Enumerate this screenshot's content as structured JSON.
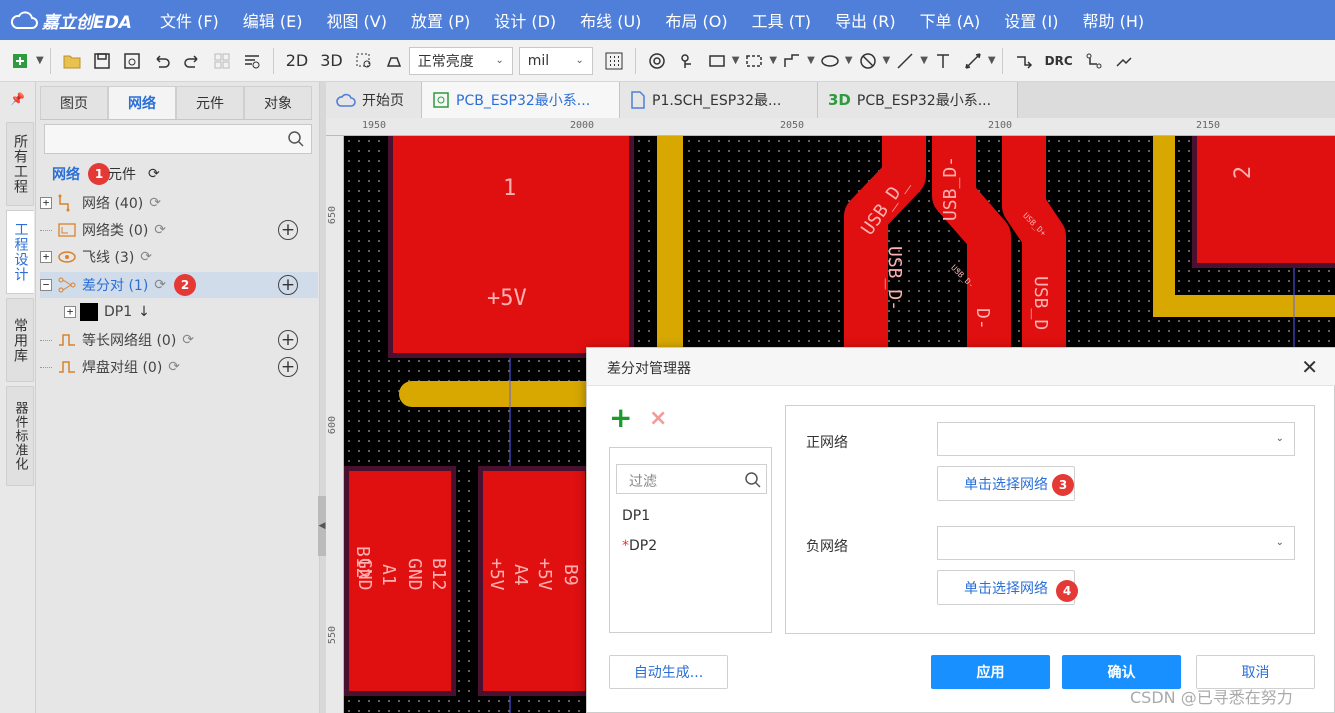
{
  "app": {
    "logo_text": "嘉立创EDA"
  },
  "menu": [
    "文件 (F)",
    "编辑 (E)",
    "视图 (V)",
    "放置 (P)",
    "设计 (D)",
    "布线 (U)",
    "布局 (O)",
    "工具 (T)",
    "导出 (R)",
    "下单 (A)",
    "设置 (I)",
    "帮助 (H)"
  ],
  "toolbar": {
    "view_2d": "2D",
    "view_3d": "3D",
    "brightness": "正常亮度",
    "unit": "mil",
    "drc": "DRC"
  },
  "vtabs": {
    "pin": "⬆",
    "all_projects": "所有工程",
    "project_design": "工程设计",
    "common_lib": "常用库",
    "standardize": "器件标准化"
  },
  "panel": {
    "tabs": [
      "图页",
      "网络",
      "元件",
      "对象"
    ],
    "active_tab": "网络",
    "filter_left": "网络",
    "filter_right": "元件",
    "tree": [
      {
        "label": "网络 (40)"
      },
      {
        "label": "网络类 (0)"
      },
      {
        "label": "飞线 (3)"
      },
      {
        "label": "差分对 (1)"
      },
      {
        "label": "DP1"
      },
      {
        "label": "等长网络组 (0)"
      },
      {
        "label": "焊盘对组 (0)"
      }
    ]
  },
  "badges": [
    "1",
    "2",
    "3",
    "4"
  ],
  "doc_tabs": [
    "开始页",
    "PCB_ESP32最小系...",
    "P1.SCH_ESP32最...",
    "PCB_ESP32最小系..."
  ],
  "ruler": {
    "top": [
      "1950",
      "2000",
      "2050",
      "2100",
      "2150"
    ],
    "left": [
      "650",
      "600",
      "550"
    ]
  },
  "pcb": {
    "pad1_label": "1",
    "pad1_net": "+5V",
    "pad2_label": "2",
    "net_labels": [
      "USB_D_",
      "USB_D-",
      "USB_D-",
      "USB_D",
      "USB_D-",
      "D-",
      "USB_D+",
      "USB_D-"
    ],
    "connector_a": [
      "B12",
      "GND",
      "A1",
      "GND"
    ],
    "connector_b": [
      "B9",
      "+5V",
      "A4",
      "+5V"
    ]
  },
  "dialog": {
    "title": "差分对管理器",
    "add_icon": "+",
    "delete_icon": "×",
    "filter_placeholder": "过滤",
    "pairs": [
      "DP1",
      "DP2"
    ],
    "pair_required_mark": "*",
    "positive_label": "正网络",
    "negative_label": "负网络",
    "select_net_button": "单击选择网络",
    "auto_generate": "自动生成...",
    "apply": "应用",
    "confirm": "确认",
    "cancel": "取消"
  },
  "watermark": "CSDN @已寻悉在努力",
  "colors": {
    "menubar": "#4f7fd9",
    "accent": "#2b6fd6",
    "primary_button": "#1890ff",
    "pad": "#e01010",
    "track": "#d8a800",
    "badge": "#e53935"
  }
}
